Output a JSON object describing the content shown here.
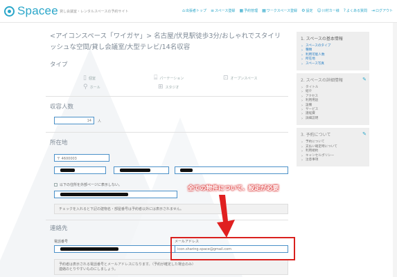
{
  "header": {
    "logo_text": "Spacee",
    "tagline": "貸し会議室・レンタルスペースの予約サイト",
    "nav": [
      {
        "icon": "home-icon",
        "glyph": "⌂",
        "label": "出張者トップ"
      },
      {
        "icon": "list-icon",
        "glyph": "≡",
        "label": "スペース登録"
      },
      {
        "icon": "calendar-icon",
        "glyph": "▦",
        "label": "予約管理"
      },
      {
        "icon": "calendar-icon",
        "glyph": "▦",
        "label": "ワークスペース登録"
      },
      {
        "icon": "gear-icon",
        "glyph": "⚙",
        "label": "設定"
      },
      {
        "icon": "user-icon",
        "glyph": "☺",
        "label": "川村カー様"
      },
      {
        "icon": "question-icon",
        "glyph": "?",
        "label": "よくある質問"
      },
      {
        "icon": "logout-icon",
        "glyph": "⇥",
        "label": "ログアウト"
      }
    ]
  },
  "main": {
    "title": "<アイコンスペース「ワイガヤ」> 名古屋/伏見駅徒歩3分/おしゃれでスタイリッシュな空間/貸し会議室/大型テレビ/14名収容",
    "type_section": {
      "heading": "タイプ",
      "options": [
        {
          "label": "個室",
          "icon": "door-icon",
          "glyph": "▯"
        },
        {
          "label": "パーテーション",
          "icon": "partition-icon",
          "glyph": "⌸"
        },
        {
          "label": "オープンスペース",
          "icon": "open-space-icon",
          "glyph": "⊡"
        },
        {
          "label": "ホール",
          "icon": "hall-icon",
          "glyph": "⚲"
        },
        {
          "label": "スタジオ",
          "icon": "studio-icon",
          "glyph": "⊞"
        }
      ]
    },
    "capacity_section": {
      "heading": "収容人数",
      "value": "14",
      "unit": "人"
    },
    "address_section": {
      "heading": "所在地",
      "postal": "〒 4600003",
      "hide_checkbox_label": "以下の住所を外部ページに表示しない。",
      "note": "チェックを入れると下記の建物名・部屋番号は予約者以外には表示されません。"
    },
    "contact_section": {
      "heading": "連絡先",
      "phone_label": "電話番号",
      "email_label": "メールアドレス",
      "email_value": "icon.sharing.space@gmail.com",
      "note_line1": "予約者は表示される電話番号とメールアドレスになります。（予約が確定した場合のみ）",
      "note_line2": "連絡のとりやすいものにしましょう。"
    }
  },
  "sidebar": {
    "groups": [
      {
        "heading": "1. スペースの基本情報",
        "active": true,
        "items": [
          "スペースのタイプ",
          "種類",
          "利用可能人数",
          "所在地",
          "スペース写真"
        ],
        "link": true
      },
      {
        "heading": "2. スペースの詳細情報",
        "active": false,
        "items": [
          "タイトル",
          "紹介",
          "アクセス",
          "利用用途",
          "設備",
          "サービス",
          "諸経費",
          "詳細説明"
        ],
        "link": false
      },
      {
        "heading": "3. 予約について",
        "active": false,
        "items": [
          "予約について",
          "支払い確定時について",
          "利用規約",
          "キャンセルポリシー",
          "注意事項"
        ],
        "link": false
      }
    ]
  },
  "annotation": {
    "callout": "全ての物件について、設定が必要"
  },
  "colors": {
    "brand": "#2aa6c9",
    "highlight": "#d9201d"
  }
}
